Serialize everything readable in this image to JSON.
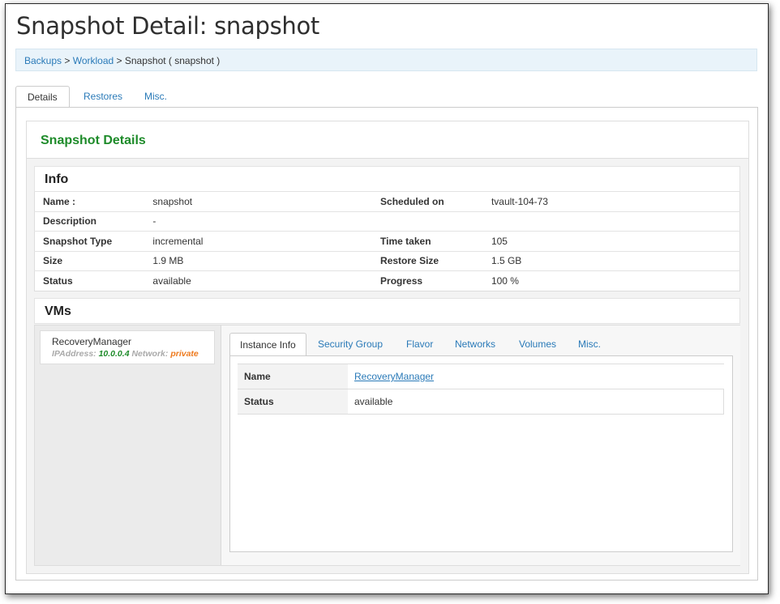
{
  "page": {
    "title": "Snapshot Detail: snapshot"
  },
  "breadcrumb": {
    "item1": "Backups",
    "sep1": " > ",
    "item2": "Workload",
    "sep2": " > ",
    "current": "Snapshot ( snapshot )"
  },
  "tabs": [
    "Details",
    "Restores",
    "Misc."
  ],
  "snapshot": {
    "heading": "Snapshot Details",
    "info_heading": "Info",
    "rows": [
      {
        "l1": "Name :",
        "v1": "snapshot",
        "l2": "Scheduled on",
        "v2": "tvault-104-73"
      },
      {
        "l1": "Description",
        "v1": "-",
        "l2": "",
        "v2": ""
      },
      {
        "l1": "Snapshot Type",
        "v1": "incremental",
        "l2": "Time taken",
        "v2": "105"
      },
      {
        "l1": "Size",
        "v1": "1.9 MB",
        "l2": "Restore Size",
        "v2": "1.5 GB"
      },
      {
        "l1": "Status",
        "v1": "available",
        "l2": "Progress",
        "v2": "100 %"
      }
    ],
    "vms_heading": "VMs"
  },
  "vm": {
    "name": "RecoveryManager",
    "ip_label": "IPAddress:",
    "ip": "10.0.0.4",
    "network_label": "Network:",
    "network": "private",
    "tabs": [
      "Instance Info",
      "Security Group",
      "Flavor",
      "Networks",
      "Volumes",
      "Misc."
    ],
    "instance": {
      "name_label": "Name",
      "name_value": "RecoveryManager",
      "status_label": "Status",
      "status_value": "available"
    }
  },
  "colors": {
    "accent_green": "#1e8b2a",
    "link_blue": "#2a7ab8",
    "network_orange": "#ee7a1e"
  }
}
